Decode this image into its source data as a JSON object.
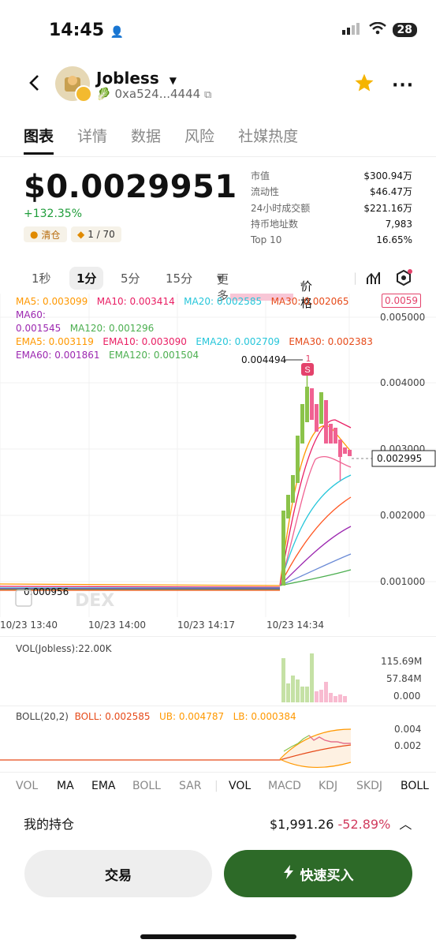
{
  "status": {
    "time": "14:45",
    "battery": "28"
  },
  "token": {
    "name": "Jobless",
    "address": "0xa524...4444"
  },
  "tabs": [
    "图表",
    "详情",
    "数据",
    "风险",
    "社媒热度"
  ],
  "price": {
    "value": "$0.0029951",
    "change": "+132.35%",
    "badge_clear": "清仓",
    "badge_rank": "1 / 70"
  },
  "stats": [
    {
      "k": "市值",
      "v": "$300.94万"
    },
    {
      "k": "流动性",
      "v": "$46.47万"
    },
    {
      "k": "24小时成交额",
      "v": "$221.16万"
    },
    {
      "k": "持币地址数",
      "v": "7,983"
    },
    {
      "k": "Top 10",
      "v": "16.65%"
    }
  ],
  "timeframes": {
    "t1": "1秒",
    "t2": "1分",
    "t3": "5分",
    "t4": "15分",
    "more": "更多",
    "price_mode": "价格"
  },
  "ma_line": {
    "ma5": "MA5: 0.003099",
    "ma10": "MA10: 0.003414",
    "ma20": "MA20: 0.002585",
    "ma30": "MA30: 0.002065",
    "ma60": "MA60:",
    "ma60v": "0.001545",
    "ma120": "MA120: 0.001296"
  },
  "ema_line": {
    "ema5": "EMA5: 0.003119",
    "ema10": "EMA10: 0.003090",
    "ema20": "EMA20: 0.002709",
    "ema30": "EMA30: 0.002383",
    "ema60": "EMA60: 0.001861",
    "ema120": "EMA120: 0.001504"
  },
  "chart_labels": {
    "high": "0.004494",
    "low": "0.000956",
    "current": "0.002995",
    "top_tag": "0.0059",
    "y_ticks": [
      "0.005000",
      "0.004000",
      "0.003000",
      "0.002000",
      "0.001000"
    ],
    "x_ticks": [
      "10/23 13:40",
      "10/23 14:00",
      "10/23 14:17",
      "10/23 14:34"
    ],
    "watermark": "DEX",
    "s_marker": "S",
    "marker_num": "1"
  },
  "volume": {
    "title": "VOL(Jobless):22.00K",
    "ticks": [
      "115.69M",
      "57.84M",
      "0.000"
    ]
  },
  "boll": {
    "title": "BOLL(20,2)",
    "boll": "BOLL: 0.002585",
    "ub": "UB: 0.004787",
    "lb": "LB: 0.000384",
    "ticks": [
      "0.004",
      "0.002"
    ]
  },
  "indicator_tabs": {
    "main": [
      "VOL",
      "MA",
      "EMA",
      "BOLL",
      "SAR"
    ],
    "sub": [
      "VOL",
      "MACD",
      "KDJ",
      "SKDJ",
      "BOLL"
    ]
  },
  "holding": {
    "label": "我的持仓",
    "value": "$1,991.26",
    "pct": "-52.89%"
  },
  "buttons": {
    "trade": "交易",
    "quick_buy": "快速买入"
  },
  "colors": {
    "up": "#8bc34a",
    "down": "#f06292",
    "accent_green": "#2d6a28",
    "price_change": "#1f9d3a",
    "loss": "#d13c5e"
  }
}
